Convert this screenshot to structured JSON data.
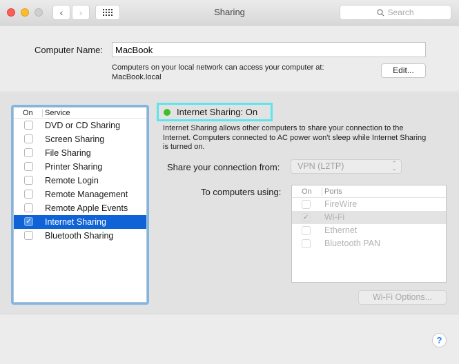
{
  "window": {
    "title": "Sharing",
    "search_placeholder": "Search",
    "back_icon": "‹",
    "forward_icon": "›"
  },
  "computer_name": {
    "label": "Computer Name:",
    "value": "MacBook",
    "description_line1": "Computers on your local network can access your computer at:",
    "description_line2": "MacBook.local",
    "edit_button": "Edit..."
  },
  "services": {
    "col_on": "On",
    "col_service": "Service",
    "items": [
      {
        "label": "DVD or CD Sharing",
        "checked": false,
        "selected": false
      },
      {
        "label": "Screen Sharing",
        "checked": false,
        "selected": false
      },
      {
        "label": "File Sharing",
        "checked": false,
        "selected": false
      },
      {
        "label": "Printer Sharing",
        "checked": false,
        "selected": false
      },
      {
        "label": "Remote Login",
        "checked": false,
        "selected": false
      },
      {
        "label": "Remote Management",
        "checked": false,
        "selected": false
      },
      {
        "label": "Remote Apple Events",
        "checked": false,
        "selected": false
      },
      {
        "label": "Internet Sharing",
        "checked": true,
        "selected": true
      },
      {
        "label": "Bluetooth Sharing",
        "checked": false,
        "selected": false
      }
    ]
  },
  "detail": {
    "status_text": "Internet Sharing: On",
    "status_color": "#3fbf26",
    "description": "Internet Sharing allows other computers to share your connection to the Internet. Computers connected to AC power won't sleep while Internet Sharing is turned on.",
    "share_from_label": "Share your connection from:",
    "share_from_value": "VPN (L2TP)",
    "to_computers_label": "To computers using:",
    "ports_col_on": "On",
    "ports_col_ports": "Ports",
    "ports": [
      {
        "label": "FireWire",
        "checked": false,
        "selected": false
      },
      {
        "label": "Wi-Fi",
        "checked": true,
        "selected": true
      },
      {
        "label": "Ethernet",
        "checked": false,
        "selected": false
      },
      {
        "label": "Bluetooth PAN",
        "checked": false,
        "selected": false
      }
    ],
    "wifi_options_button": "Wi-Fi Options..."
  },
  "help_button": "?",
  "checkmark": "✓"
}
